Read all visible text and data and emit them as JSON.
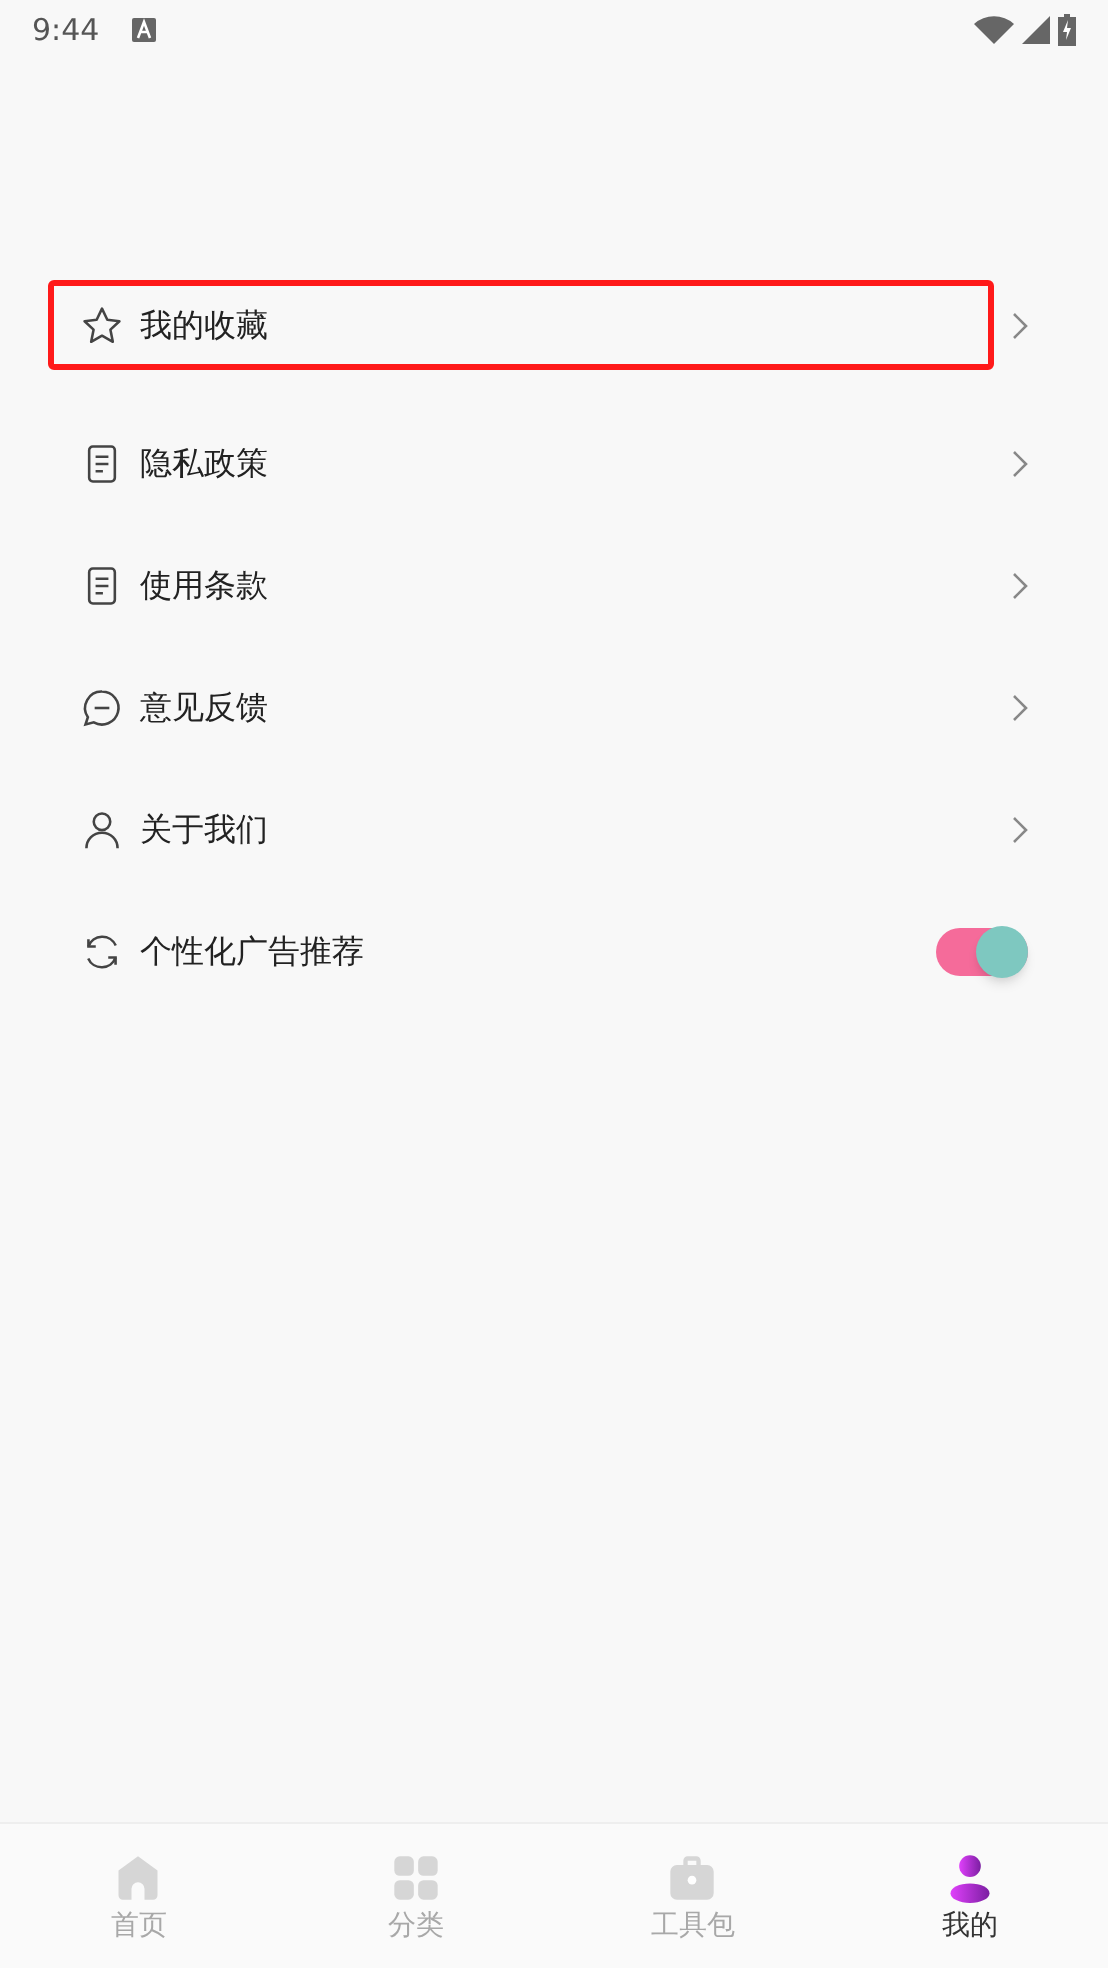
{
  "status_bar": {
    "time": "9:44"
  },
  "menu": [
    {
      "kind": "link",
      "label": "我的收藏",
      "highlighted": true
    },
    {
      "kind": "link",
      "label": "隐私政策",
      "highlighted": false
    },
    {
      "kind": "link",
      "label": "使用条款",
      "highlighted": false
    },
    {
      "kind": "link",
      "label": "意见反馈",
      "highlighted": false
    },
    {
      "kind": "link",
      "label": "关于我们",
      "highlighted": false
    },
    {
      "kind": "toggle",
      "label": "个性化广告推荐",
      "highlighted": false,
      "on": true
    }
  ],
  "bottom_nav": [
    {
      "label": "首页",
      "selected": false
    },
    {
      "label": "分类",
      "selected": false
    },
    {
      "label": "工具包",
      "selected": false
    },
    {
      "label": "我的",
      "selected": true
    }
  ]
}
